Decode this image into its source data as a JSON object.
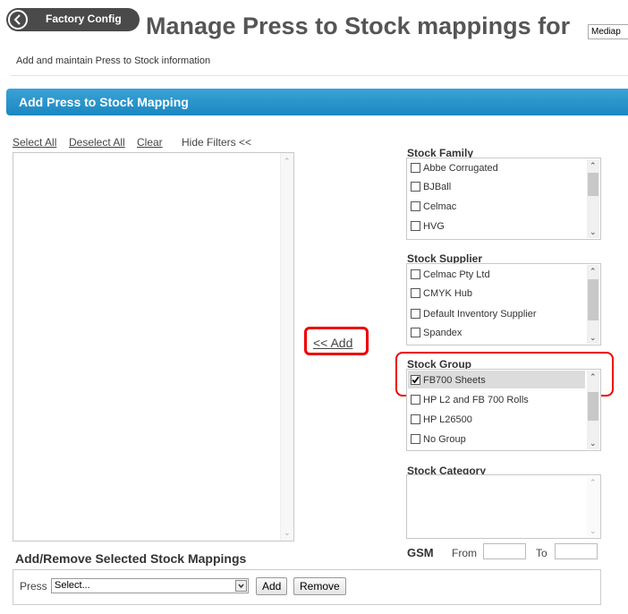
{
  "header": {
    "back_button_label": "Factory Config",
    "title": "Manage Press to Stock mappings for",
    "dealer_selected": "Mediap",
    "subtitle": "Add and maintain Press to Stock information"
  },
  "section": {
    "title": "Add Press to Stock Mapping"
  },
  "list_controls": {
    "select_all": "Select All",
    "deselect_all": "Deselect All",
    "clear": "Clear",
    "hide_filters": "Hide Filters <<"
  },
  "add_link": "<< Add",
  "filters": {
    "stock_family": {
      "label": "Stock Family",
      "items": [
        {
          "label": "Abbe Corrugated",
          "checked": false
        },
        {
          "label": "BJBall",
          "checked": false
        },
        {
          "label": "Celmac",
          "checked": false
        },
        {
          "label": "HVG",
          "checked": false
        }
      ]
    },
    "stock_supplier": {
      "label": "Stock Supplier",
      "items": [
        {
          "label": "Celmac Pty Ltd",
          "checked": false
        },
        {
          "label": "CMYK Hub",
          "checked": false
        },
        {
          "label": "Default Inventory Supplier",
          "checked": false
        },
        {
          "label": "Spandex",
          "checked": false
        }
      ]
    },
    "stock_group": {
      "label": "Stock Group",
      "items": [
        {
          "label": "FB700 Sheets",
          "checked": true
        },
        {
          "label": "HP L2 and FB 700 Rolls",
          "checked": false
        },
        {
          "label": "HP L26500",
          "checked": false
        },
        {
          "label": "No Group",
          "checked": false
        }
      ]
    },
    "stock_category": {
      "label": "Stock Category",
      "items": []
    }
  },
  "gsm": {
    "label": "GSM",
    "from_label": "From",
    "to_label": "To",
    "from_value": "",
    "to_value": ""
  },
  "bottom": {
    "title": "Add/Remove Selected Stock Mappings",
    "press_label": "Press",
    "press_selected": "Select...",
    "add_button": "Add",
    "remove_button": "Remove"
  }
}
